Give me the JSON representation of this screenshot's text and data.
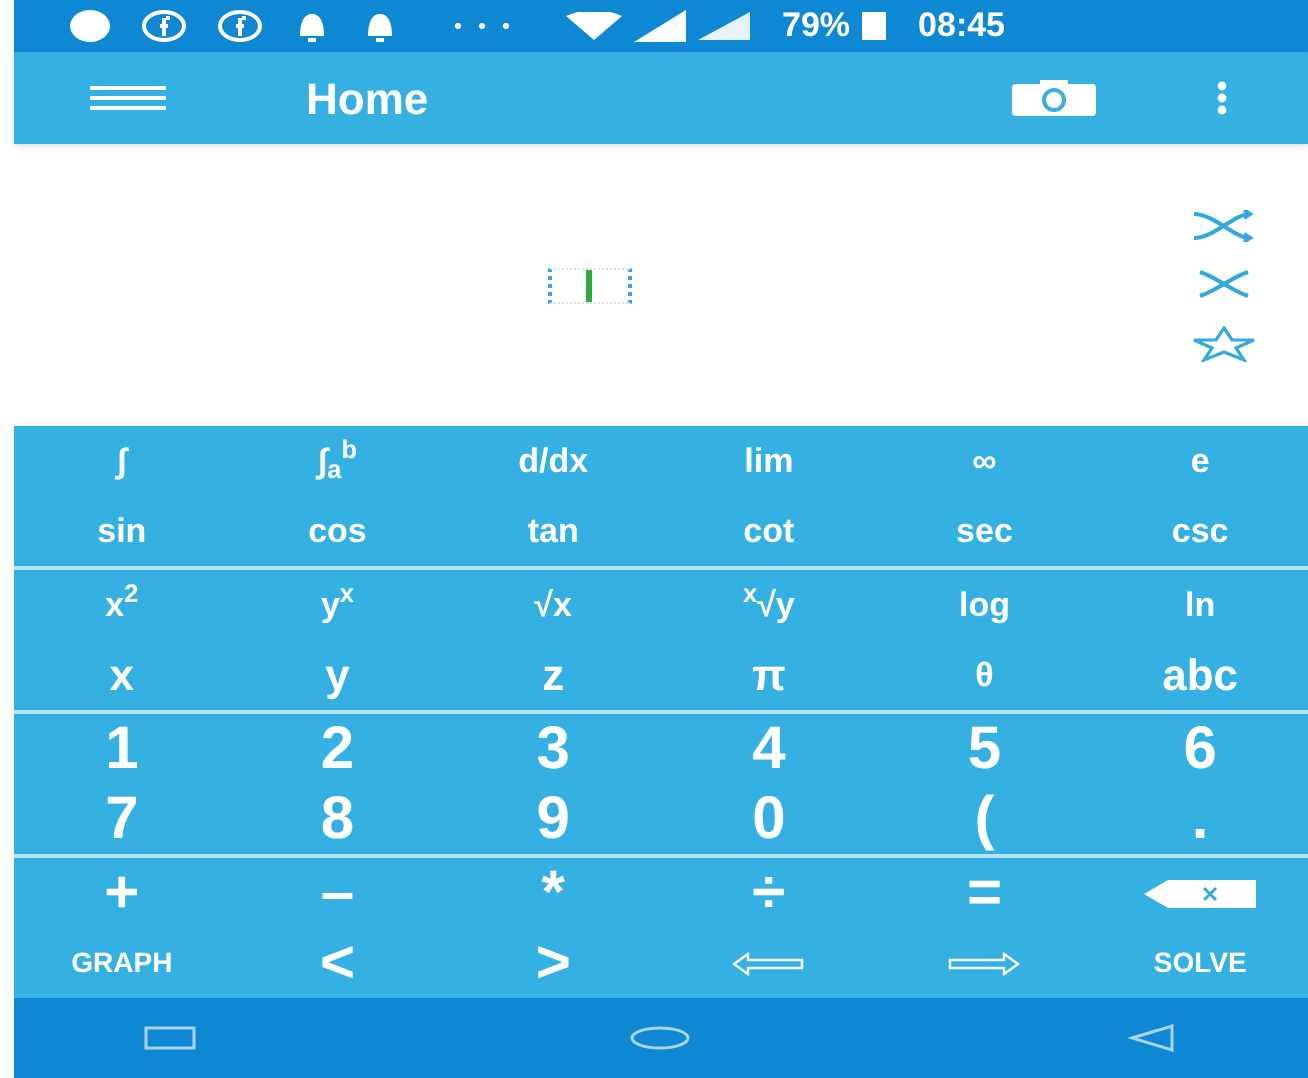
{
  "status_bar": {
    "battery": "79%",
    "time": "08:45"
  },
  "app_bar": {
    "title": "Home"
  },
  "keypad": {
    "groups": [
      {
        "rows": [
          [
            {
              "kind": "text",
              "label": "∫"
            },
            {
              "kind": "text",
              "label": "∫$_{a}$$^{b}$"
            },
            {
              "kind": "text",
              "label": "d/dx"
            },
            {
              "kind": "text",
              "label": "lim"
            },
            {
              "kind": "text",
              "label": "∞"
            },
            {
              "kind": "text",
              "label": "e"
            }
          ],
          [
            {
              "kind": "text",
              "label": "sin"
            },
            {
              "kind": "text",
              "label": "cos"
            },
            {
              "kind": "text",
              "label": "tan"
            },
            {
              "kind": "text",
              "label": "cot"
            },
            {
              "kind": "text",
              "label": "sec"
            },
            {
              "kind": "text",
              "label": "csc"
            }
          ]
        ]
      },
      {
        "rows": [
          [
            {
              "kind": "text",
              "label": "x$^{2}$"
            },
            {
              "kind": "text",
              "label": "y$^{x}$"
            },
            {
              "kind": "text",
              "label": "√x"
            },
            {
              "kind": "text",
              "label": "$^{x}$√y"
            },
            {
              "kind": "text",
              "label": "log"
            },
            {
              "kind": "text",
              "label": "ln"
            }
          ],
          [
            {
              "kind": "big",
              "label": "x"
            },
            {
              "kind": "big",
              "label": "y"
            },
            {
              "kind": "big",
              "label": "z"
            },
            {
              "kind": "big",
              "label": "π"
            },
            {
              "kind": "text",
              "label": "θ"
            },
            {
              "kind": "big",
              "label": "abc"
            }
          ]
        ]
      },
      {
        "rows": [
          [
            {
              "kind": "digit",
              "label": "1"
            },
            {
              "kind": "digit",
              "label": "2"
            },
            {
              "kind": "digit",
              "label": "3"
            },
            {
              "kind": "digit",
              "label": "4"
            },
            {
              "kind": "digit",
              "label": "5"
            },
            {
              "kind": "digit",
              "label": "6"
            }
          ],
          [
            {
              "kind": "digit",
              "label": "7"
            },
            {
              "kind": "digit",
              "label": "8"
            },
            {
              "kind": "digit",
              "label": "9"
            },
            {
              "kind": "digit",
              "label": "0"
            },
            {
              "kind": "digit",
              "label": "("
            },
            {
              "kind": "digit",
              "label": "."
            }
          ]
        ]
      },
      {
        "rows": [
          [
            {
              "kind": "digit",
              "label": "+"
            },
            {
              "kind": "digit",
              "label": "–"
            },
            {
              "kind": "digit",
              "label": "*"
            },
            {
              "kind": "digit",
              "label": "÷"
            },
            {
              "kind": "digit",
              "label": "="
            },
            {
              "kind": "backspace"
            }
          ],
          [
            {
              "kind": "small",
              "label": "GRAPH"
            },
            {
              "kind": "digit",
              "label": "<"
            },
            {
              "kind": "digit",
              "label": ">"
            },
            {
              "kind": "left"
            },
            {
              "kind": "right"
            },
            {
              "kind": "small",
              "label": "SOLVE"
            }
          ]
        ]
      }
    ]
  }
}
